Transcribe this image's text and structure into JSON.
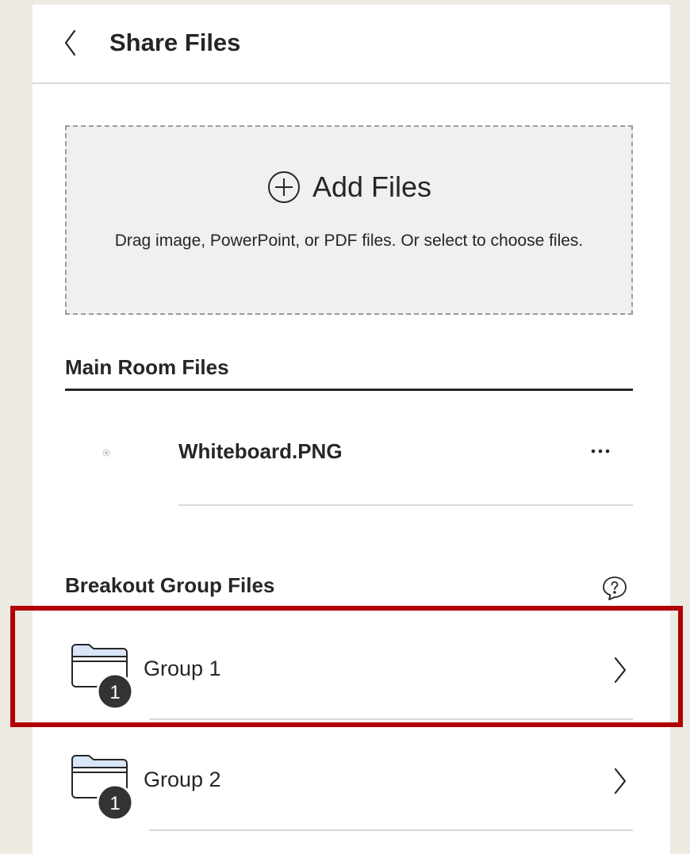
{
  "header": {
    "title": "Share Files"
  },
  "dropzone": {
    "add_label": "Add Files",
    "help_text": "Drag image, PowerPoint, or PDF files. Or select to choose files."
  },
  "main_room": {
    "title": "Main Room Files",
    "files": [
      {
        "name": "Whiteboard.PNG"
      }
    ]
  },
  "breakout": {
    "title": "Breakout Group Files",
    "groups": [
      {
        "name": "Group 1",
        "count": "1"
      },
      {
        "name": "Group 2",
        "count": "1"
      }
    ]
  },
  "colors": {
    "background": "#edeae1",
    "panel": "#ffffff",
    "dropzone": "#f0f0f0",
    "text": "#262626",
    "folder_tab": "#d8e6f7",
    "badge": "#333333",
    "highlight": "#b00000"
  },
  "icons": {
    "back": "chevron-left-icon",
    "add": "plus-circle-icon",
    "file": "file-dot-icon",
    "more": "more-icon",
    "help": "help-bubble-icon",
    "folder": "folder-icon",
    "next": "chevron-right-icon"
  }
}
